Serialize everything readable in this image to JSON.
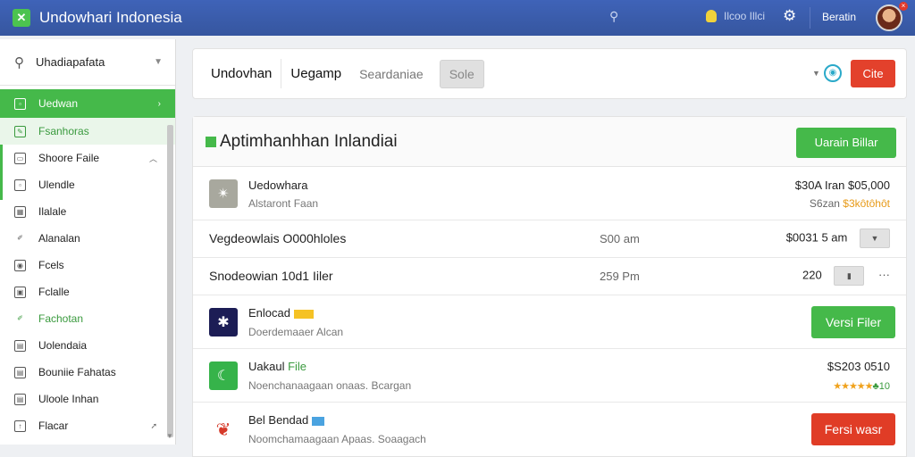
{
  "app": {
    "title": "Undowhari Indonesia"
  },
  "topbar": {
    "search_icon": "search-icon",
    "notification_text": "Ilcoo Illci",
    "user_name": "Beratin"
  },
  "sidebar": {
    "search_label": "Uhadiapafata",
    "items": [
      {
        "label": "Uedwan",
        "icon": "square-icon",
        "active": true
      },
      {
        "label": "Fsanhoras",
        "icon": "edit-icon"
      },
      {
        "label": "Shoore Faile",
        "icon": "folder-icon"
      },
      {
        "label": "Ulendle",
        "icon": "square-icon"
      },
      {
        "label": "Ilalale",
        "icon": "grid-icon"
      },
      {
        "label": "Alanalan",
        "icon": "pen-icon"
      },
      {
        "label": "Fcels",
        "icon": "people-icon"
      },
      {
        "label": "Fclalle",
        "icon": "image-icon"
      },
      {
        "label": "Fachotan",
        "icon": "pen-icon"
      },
      {
        "label": "Uolendaia",
        "icon": "file-icon"
      },
      {
        "label": "Bouniie Fahatas",
        "icon": "file-icon"
      },
      {
        "label": "Uloole Inhan",
        "icon": "file-icon"
      },
      {
        "label": "Flacar",
        "icon": "upload-icon"
      }
    ]
  },
  "header": {
    "tabs": [
      "Undovhan",
      "Uegamp",
      "Seardaniae",
      "Sole"
    ],
    "button_label": "Cite"
  },
  "main": {
    "title": "Aptimhanhhan Inlandiai",
    "add_button_label": "Uarain Billar",
    "rows": [
      {
        "title": "Uedowhara",
        "subtitle": "Alstaront Faan",
        "price": "$30A Iran $05,000",
        "price_sub_prefix": "S6zan ",
        "price_sub_rating": "$3kôtôhôt"
      },
      {
        "title": "Vegdeowlais O000hloles",
        "time": "S00 am",
        "amount": "$0031 5 am"
      },
      {
        "title": "Snodeowian 10d1 Iiler",
        "time": "259 Pm",
        "amount": "220"
      },
      {
        "title": "Enlocad",
        "subtitle": "Doerdemaaer Alcan",
        "action_label": "Versi Filer"
      },
      {
        "title_prefix": "Uakaul ",
        "title_highlight": "File",
        "subtitle": "Noenchanaagaan onaas. Bcargan",
        "price": "$S203 0510",
        "stars": "★★★★★",
        "stars_suffix": "♣10"
      },
      {
        "title": "Bel Bendad",
        "subtitle": "Noomchamaagaan Apaas. Soaagach",
        "action_label": "Fersi wasr"
      }
    ]
  },
  "colors": {
    "topbar": "#3f63b8",
    "accent_green": "#45b94a",
    "accent_red": "#e03c26",
    "info_cyan": "#2aa9c9"
  }
}
